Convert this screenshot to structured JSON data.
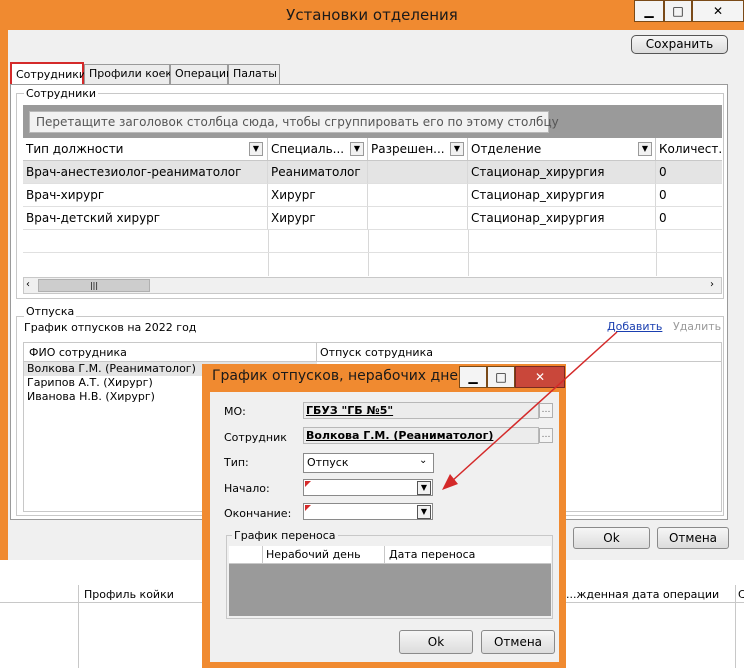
{
  "window": {
    "title": "Установки отделения",
    "save_label": "Сохранить",
    "ok_label": "Ok",
    "cancel_label": "Отмена"
  },
  "tabs": [
    {
      "label": "Сотрудники",
      "active": true
    },
    {
      "label": "Профили коек"
    },
    {
      "label": "Операции"
    },
    {
      "label": "Палаты"
    }
  ],
  "staff": {
    "group_title": "Сотрудники",
    "drag_hint": "Перетащите заголовок столбца сюда, чтобы сгруппировать его по этому столбцу",
    "columns": [
      "Тип должности",
      "Специаль...",
      "Разрешен...",
      "Отделение",
      "Количест..."
    ],
    "rows": [
      [
        "Врач-анестезиолог-реаниматолог",
        "Реаниматолог",
        "",
        "Стационар_хирургия",
        "0"
      ],
      [
        "Врач-хирург",
        "Хирург",
        "",
        "Стационар_хирургия",
        "0"
      ],
      [
        "Врач-детский хирург",
        "Хирург",
        "",
        "Стационар_хирургия",
        "0"
      ]
    ]
  },
  "vacations": {
    "group_title": "Отпуска",
    "schedule_label": "График отпусков на 2022 год",
    "add_link": "Добавить",
    "delete_link": "Удалить",
    "columns": [
      "ФИО сотрудника",
      "Отпуск сотрудника"
    ],
    "rows": [
      "Волкова Г.М. (Реаниматолог)",
      "Гарипов А.Т. (Хирург)",
      "Иванова Н.В. (Хирург)"
    ]
  },
  "background_grid": {
    "columns": [
      "Профиль койки",
      "...жденная дата операции",
      "С"
    ]
  },
  "dialog": {
    "title": "График отпусков, нерабочих дней...",
    "mo_label": "МО:",
    "mo_value": "ГБУЗ \"ГБ №5\"",
    "employee_label": "Сотрудник",
    "employee_value": "Волкова Г.М. (Реаниматолог)",
    "type_label": "Тип:",
    "type_value": "Отпуск",
    "start_label": "Начало:",
    "end_label": "Окончание:",
    "transfer_group_title": "График переноса",
    "transfer_columns": [
      "Нерабочий день",
      "Дата переноса"
    ],
    "ok_label": "Ok",
    "cancel_label": "Отмена"
  },
  "colors": {
    "window_frame": "#f08a30",
    "active_tab_border": "#d42a2a",
    "annotation_arrow": "#d42a2a",
    "link": "#1a3fb0"
  }
}
